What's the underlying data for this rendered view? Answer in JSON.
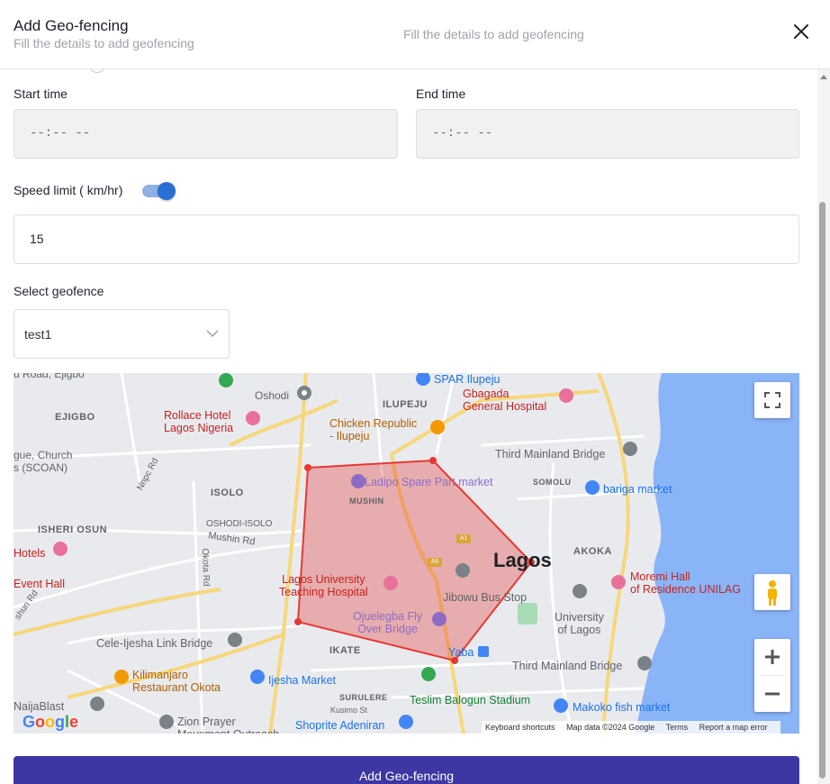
{
  "header": {
    "title": "Add Geo-fencing",
    "subtitle": "Fill the details to add geofencing",
    "center_subtitle": "Fill the details to add geofencing"
  },
  "form": {
    "start_time_label": "Start time",
    "start_time_value": "--:-- --",
    "end_time_label": "End time",
    "end_time_value": "--:-- --",
    "speed_limit_label": "Speed limit ( km/hr)",
    "speed_limit_enabled": true,
    "speed_limit_value": "15",
    "geofence_label": "Select geofence",
    "geofence_selected": "test1"
  },
  "map": {
    "city": "Lagos",
    "places": {
      "ejigbo": "EJIGBO",
      "isolo": "ISOLO",
      "isheri_osun": "ISHERI OSUN",
      "oshodi_isolo": "OSHODI-ISOLO",
      "ilupeju": "ILUPEJU",
      "mushin": "MUSHIN",
      "somolu": "SOMOLU",
      "akoka": "AKOKA",
      "ikate": "IKATE",
      "surulere": "SURULERE",
      "oshodi": "Oshodi",
      "road_ejigbo": "u Road, Ejigbo",
      "church": "gue, Church\ns (SCOAN)",
      "hotels": "Hotels",
      "event_hall": "Event Hall",
      "mushin_rd": "Mushin Rd",
      "okota_rd": "Okota Rd",
      "nnpc_rd": "Nnpc Rd",
      "shun_rd": "shun Rd",
      "kusimo": "Kusimo St"
    },
    "pois": {
      "spar": "SPAR Ilupeju",
      "gbagada": "Gbagada\nGeneral Hospital",
      "rollace": "Rollace Hotel\nLagos Nigeria",
      "chicken": "Chicken Republic\n- Ilupeju",
      "third_mainland_top": "Third Mainland Bridge",
      "ladipo": "Ladipo Spare Part market",
      "bariga": "bariga market",
      "luth": "Lagos University\nTeaching Hospital",
      "jibowu": "Jibowu Bus Stop",
      "moremi": "Moremi Hall\nof Residence UNILAG",
      "unilag": "University\nof Lagos",
      "ojuelegba": "Ojuelegba Fly\nOver Bridge",
      "yaba": "Yaba",
      "cele": "Cele-Ijesha Link Bridge",
      "third_mainland_bottom": "Third Mainland Bridge",
      "kilimanjaro": "Kilimanjaro\nRestaurant Okota",
      "ijesha": "Ijesha Market",
      "teslim": "Teslim Balogun Stadium",
      "makoko": "Makoko fish market",
      "naijablast": "NaijaBlast",
      "zion": "Zion Prayer\nMovement Outreach",
      "shoprite": "Shoprite Adeniran"
    },
    "road_tags": {
      "a1": "A1",
      "a5": "A5"
    },
    "logo": "Google",
    "attribution": {
      "shortcuts": "Keyboard shortcuts",
      "data": "Map data ©2024 Google",
      "terms": "Terms",
      "report": "Report a map error"
    },
    "polygon_color": "#e53935",
    "water_color": "#8ab4f8"
  },
  "submit_label": "Add Geo-fencing",
  "colors": {
    "primary": "#3d37a3",
    "toggle_on": "#2a6fd1"
  }
}
